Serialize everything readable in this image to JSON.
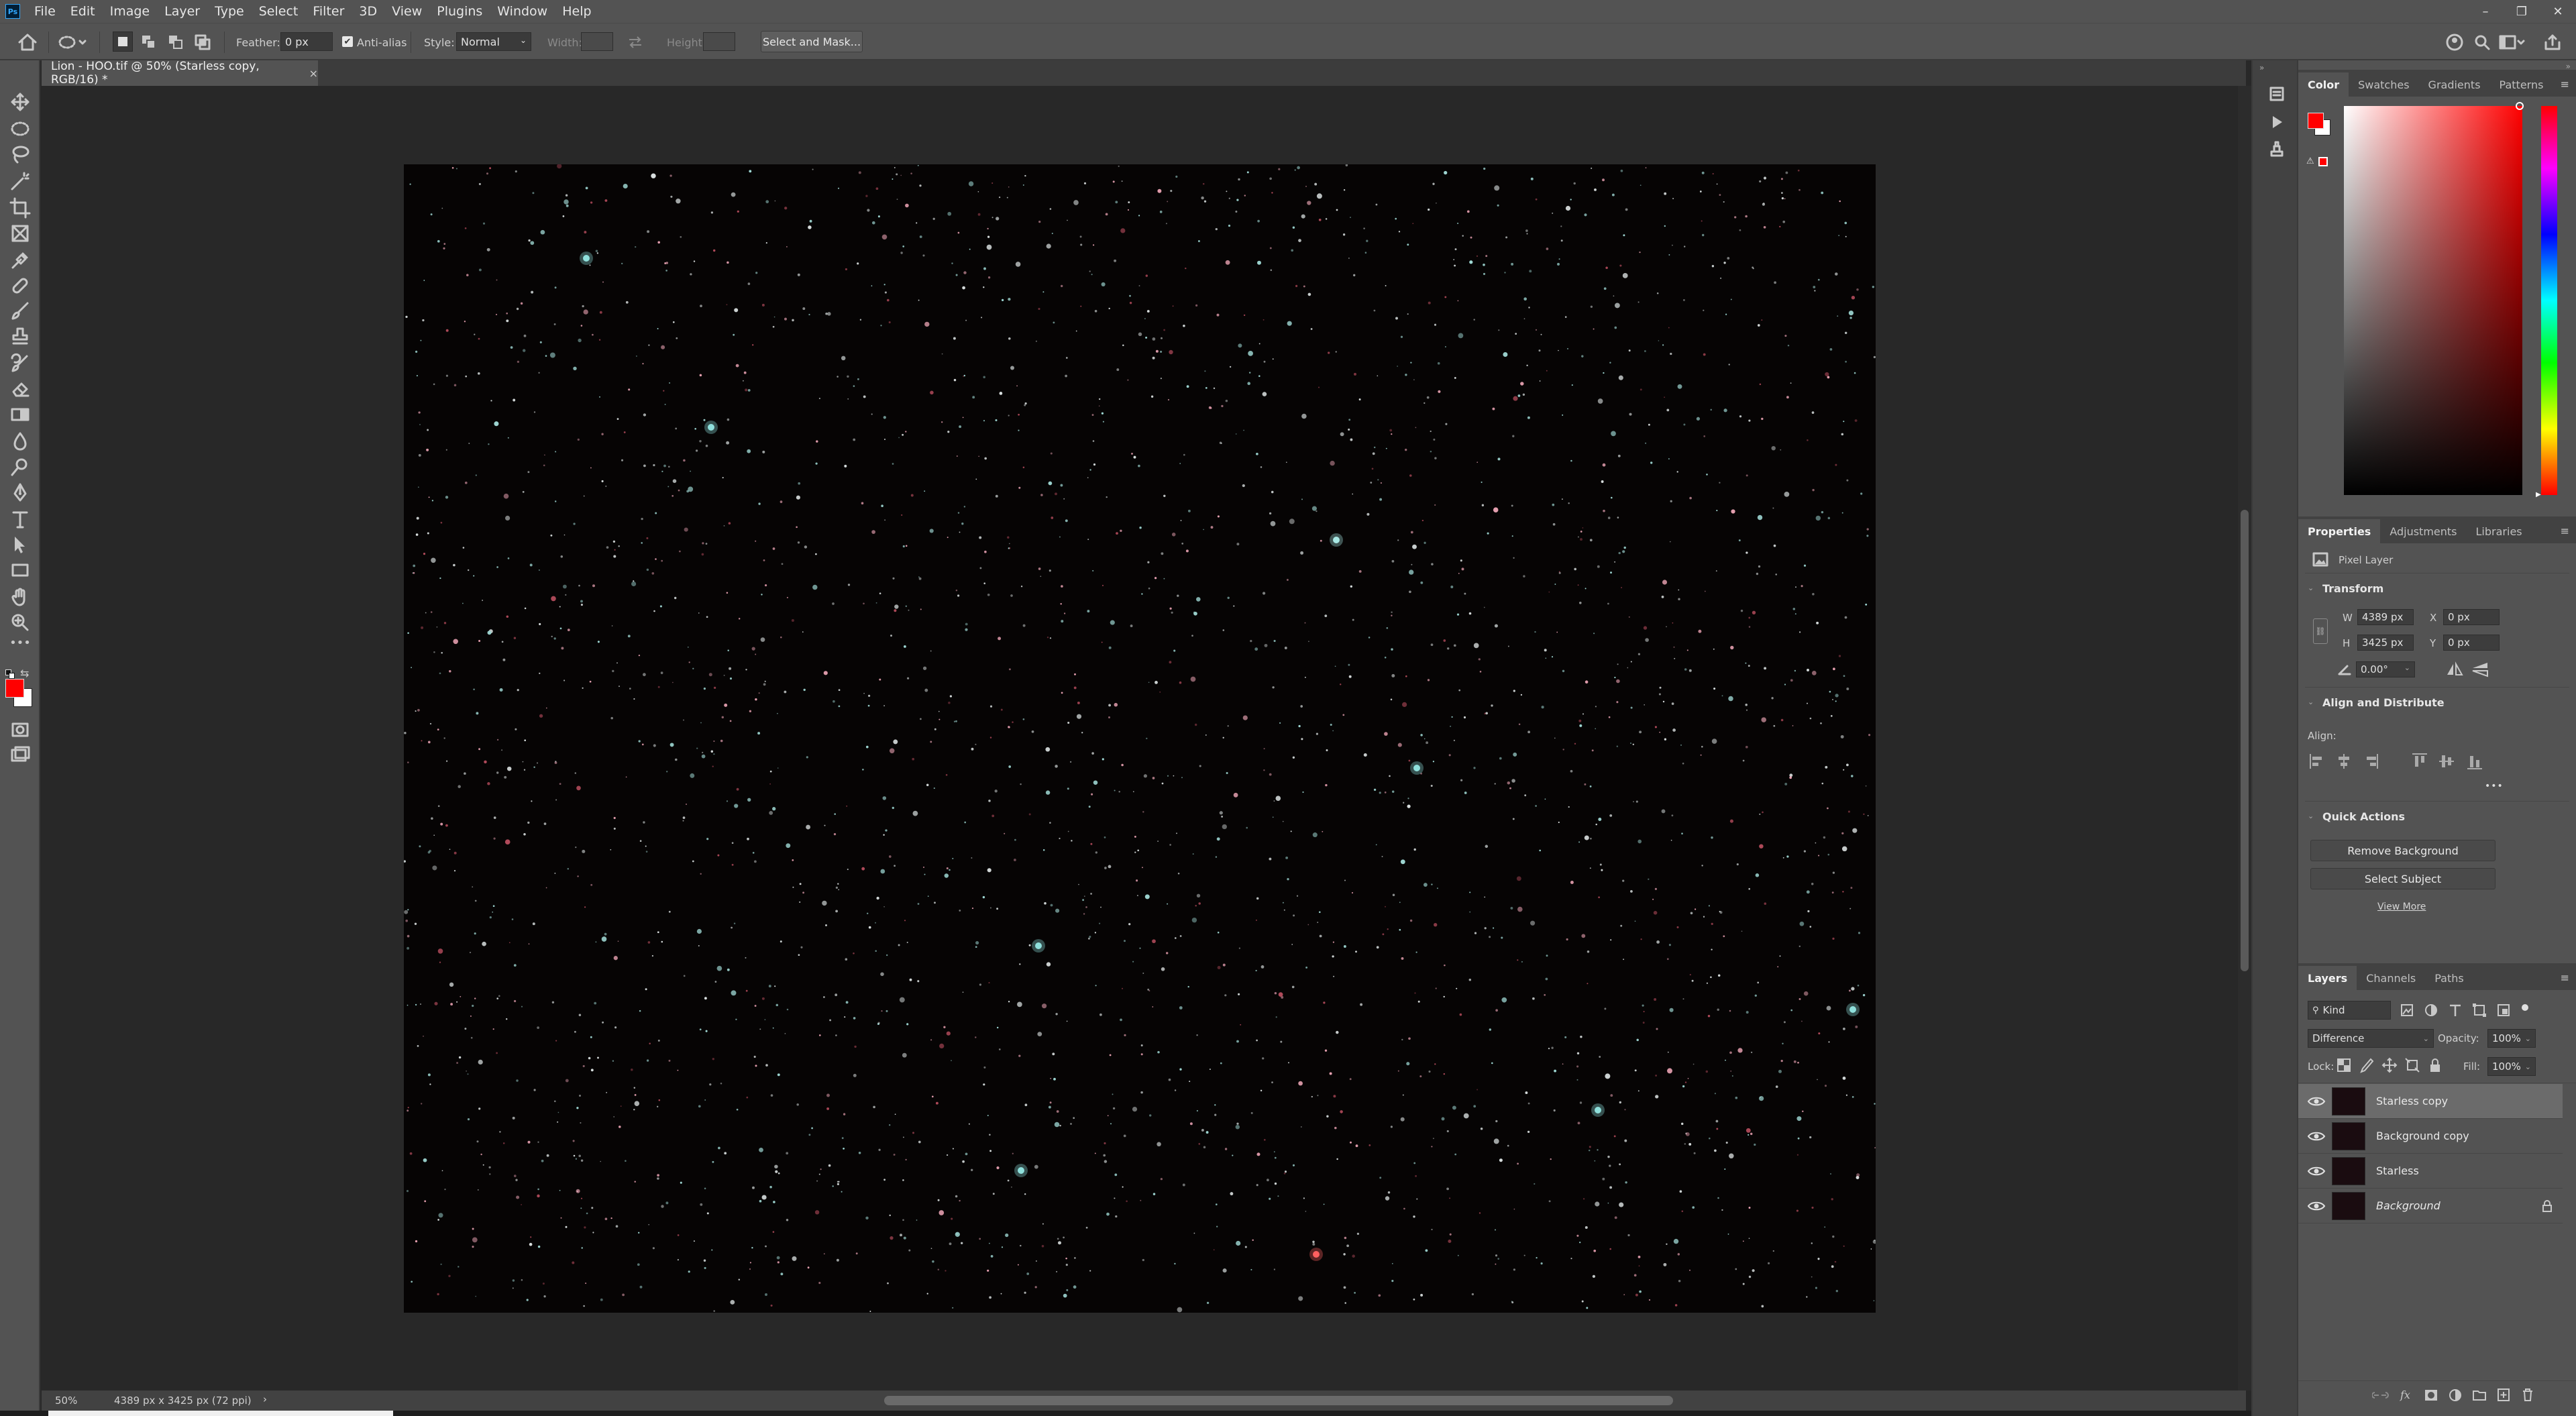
{
  "app": {
    "logo": "Ps"
  },
  "menu": [
    "File",
    "Edit",
    "Image",
    "Layer",
    "Type",
    "Select",
    "Filter",
    "3D",
    "View",
    "Plugins",
    "Window",
    "Help"
  ],
  "window_controls": {
    "minimize": "–",
    "restore": "❐",
    "close": "✕"
  },
  "options": {
    "feather_label": "Feather:",
    "feather_value": "0 px",
    "antialias_label": "Anti-alias",
    "style_label": "Style:",
    "style_value": "Normal",
    "width_label": "Width:",
    "height_label": "Height:",
    "select_mask": "Select and Mask..."
  },
  "document": {
    "tab_title": "Lion - HOO.tif @ 50% (Starless copy, RGB/16) *",
    "close": "×"
  },
  "status": {
    "zoom": "50%",
    "info": "4389 px x 3425 px (72 ppi)",
    "arrow": "›"
  },
  "color_panel": {
    "tabs": [
      "Color",
      "Swatches",
      "Gradients",
      "Patterns"
    ],
    "foreground": "#ff0000",
    "background": "#ffffff"
  },
  "properties_panel": {
    "tabs": [
      "Properties",
      "Adjustments",
      "Libraries"
    ],
    "layer_type": "Pixel Layer",
    "transform_title": "Transform",
    "w_label": "W",
    "w_value": "4389 px",
    "h_label": "H",
    "h_value": "3425 px",
    "x_label": "X",
    "x_value": "0 px",
    "y_label": "Y",
    "y_value": "0 px",
    "angle_value": "0.00°",
    "align_title": "Align and Distribute",
    "align_label": "Align:",
    "more": "•••",
    "quick_title": "Quick Actions",
    "remove_bg": "Remove Background",
    "select_subject": "Select Subject",
    "view_more": "View More"
  },
  "layers_panel": {
    "tabs": [
      "Layers",
      "Channels",
      "Paths"
    ],
    "kind_label": "Kind",
    "blend_mode": "Difference",
    "opacity_label": "Opacity:",
    "opacity_value": "100%",
    "lock_label": "Lock:",
    "fill_label": "Fill:",
    "fill_value": "100%",
    "layers": [
      {
        "name": "Starless copy",
        "selected": true
      },
      {
        "name": "Background copy",
        "selected": false
      },
      {
        "name": "Starless",
        "selected": false
      },
      {
        "name": "Background",
        "selected": false,
        "locked": true
      }
    ]
  },
  "colors": {
    "accent": "#31a8ff",
    "canvas_bg": "#060404",
    "selected_layer": "#6b6b6b"
  }
}
